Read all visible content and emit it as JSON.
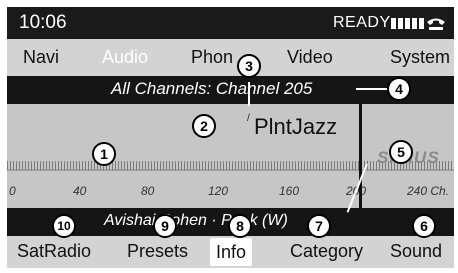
{
  "status": {
    "time": "10:06",
    "ready_label": "READY"
  },
  "main_menu": {
    "items": [
      "Navi",
      "Audio",
      "Phon",
      "Video",
      "System"
    ],
    "active_index": 1
  },
  "channel_bar": {
    "text": "All Channels: Channel 205"
  },
  "station": {
    "name": "PlntJazz",
    "logo": "SIRIUS"
  },
  "scale": {
    "labels": [
      "0",
      "40",
      "80",
      "120",
      "160",
      "200",
      "240 Ch."
    ],
    "current_channel": 205
  },
  "program": {
    "text": "Avishai Cohen · Punk (W)"
  },
  "soft_menu": {
    "items": [
      "SatRadio",
      "Presets",
      "Info",
      "Category",
      "Sound"
    ],
    "selected_index": 2
  },
  "callouts": [
    "1",
    "2",
    "3",
    "4",
    "5",
    "6",
    "7",
    "8",
    "9",
    "10"
  ],
  "colors": {
    "bar_dark": "#151515",
    "menu_grey": "#d3d3d3",
    "content_grey": "#c6c6c6",
    "text_white": "#ffffff"
  }
}
